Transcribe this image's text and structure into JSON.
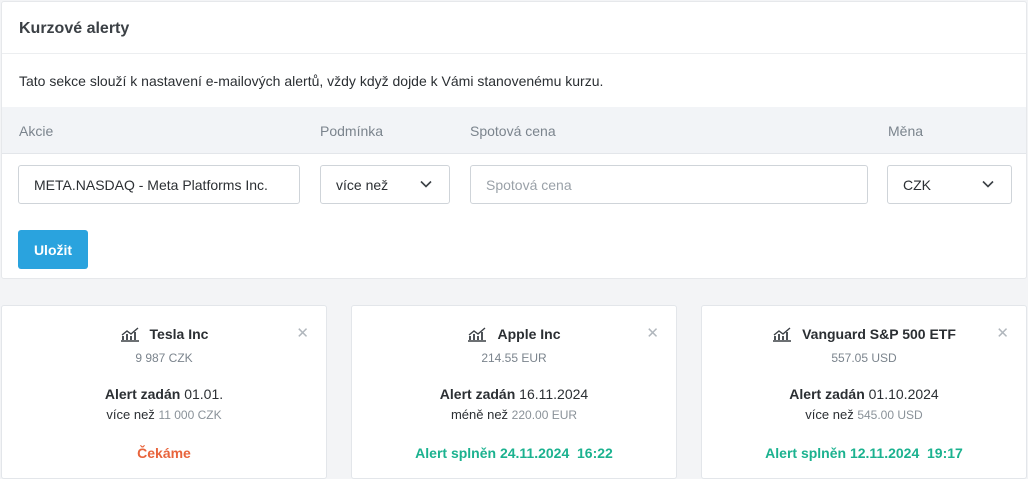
{
  "panel": {
    "title": "Kurzové alerty",
    "intro": "Tato sekce slouží k nastavení e-mailových alertů, vždy když dojde k Vámi stanovenému kurzu."
  },
  "form": {
    "headers": {
      "stock": "Akcie",
      "condition": "Podmínka",
      "spot": "Spotová cena",
      "currency": "Měna"
    },
    "stock_value": "META.NASDAQ - Meta Platforms Inc.",
    "condition_value": "více než",
    "spot_placeholder": "Spotová cena",
    "currency_value": "CZK",
    "save_label": "Uložit"
  },
  "colors": {
    "accent": "#2aa3de",
    "waiting": "#e8643c",
    "fulfilled": "#1bb28f"
  },
  "alerts": [
    {
      "name": "Tesla Inc",
      "price": "9 987 CZK",
      "set_label": "Alert zadán",
      "set_date": "01.01.",
      "condition": "více než",
      "threshold": "11 000 CZK",
      "status": "Čekáme",
      "status_type": "waiting",
      "icon": "chart-trend-icon"
    },
    {
      "name": "Apple Inc",
      "price": "214.55 EUR",
      "set_label": "Alert zadán",
      "set_date": "16.11.2024",
      "condition": "méně než",
      "threshold": "220.00 EUR",
      "status": "Alert splněn 24.11.2024  16:22",
      "status_type": "fulfilled",
      "icon": "chart-trend-icon"
    },
    {
      "name": "Vanguard S&P 500 ETF",
      "price": "557.05 USD",
      "set_label": "Alert zadán",
      "set_date": "01.10.2024",
      "condition": "více než",
      "threshold": "545.00 USD",
      "status": "Alert splněn 12.11.2024  19:17",
      "status_type": "fulfilled",
      "icon": "chart-trend-icon"
    }
  ]
}
